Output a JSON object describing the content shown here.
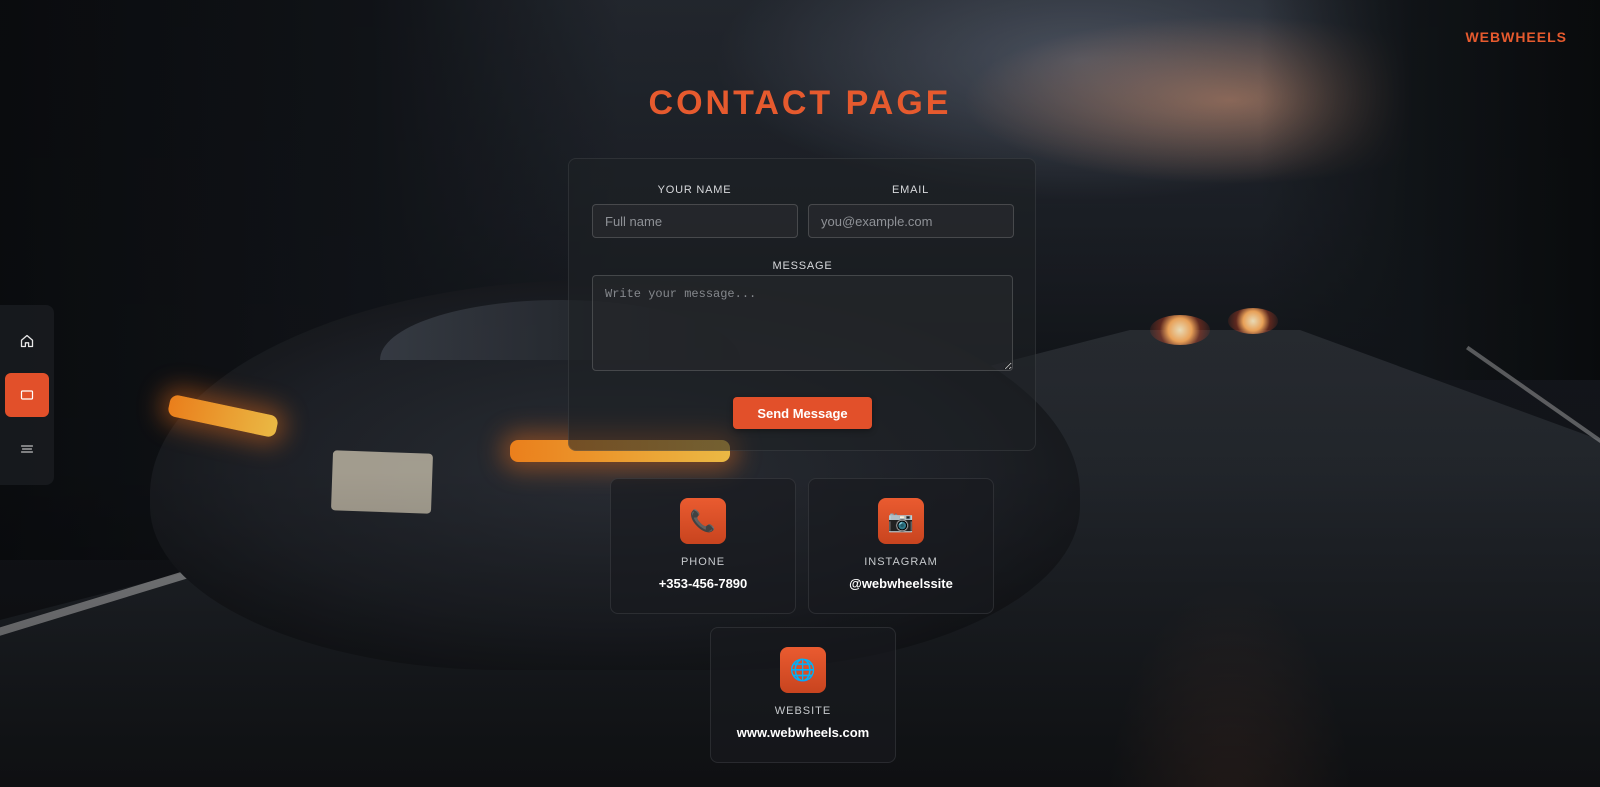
{
  "brand": "WEBWHEELS",
  "page_title": "CONTACT PAGE",
  "nav": {
    "items": [
      {
        "icon": "home-icon",
        "active": false
      },
      {
        "icon": "contact-card-icon",
        "active": true
      },
      {
        "icon": "menu-lines-icon",
        "active": false
      }
    ]
  },
  "form": {
    "name_label": "YOUR NAME",
    "name_placeholder": "Full name",
    "email_label": "EMAIL",
    "email_placeholder": "you@example.com",
    "message_label": "MESSAGE",
    "message_placeholder": "Write your message...",
    "submit_label": "Send Message"
  },
  "contacts": [
    {
      "icon": "phone-icon",
      "glyph": "📞",
      "label": "PHONE",
      "value": "+353-456-7890"
    },
    {
      "icon": "camera-icon",
      "glyph": "📷",
      "label": "INSTAGRAM",
      "value": "@webwheelssite"
    },
    {
      "icon": "globe-icon",
      "glyph": "🌐",
      "label": "WEBSITE",
      "value": "www.webwheels.com"
    }
  ],
  "colors": {
    "accent": "#e2502a",
    "title": "#e65a2e"
  }
}
